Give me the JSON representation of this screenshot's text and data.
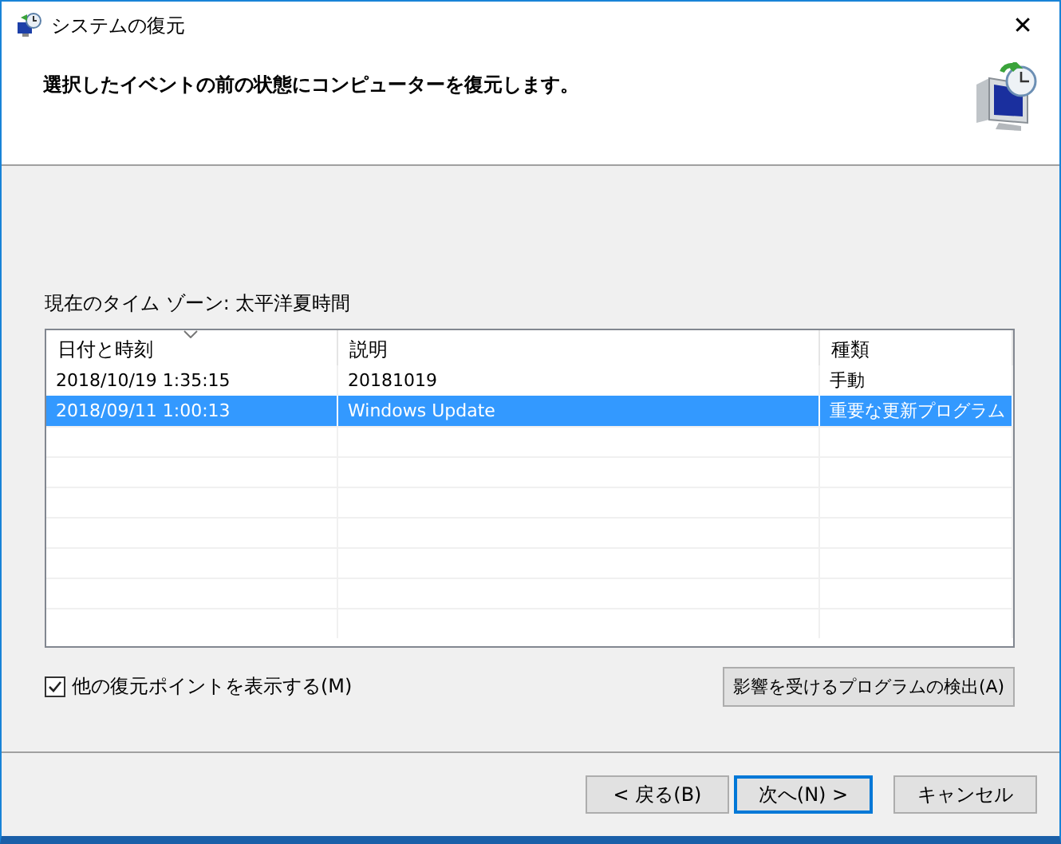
{
  "window": {
    "title": "システムの復元",
    "close": "✕"
  },
  "header": {
    "instruction": "選択したイベントの前の状態にコンピューターを復元します。"
  },
  "timezone": "現在のタイム ゾーン: 太平洋夏時間",
  "table": {
    "columns": [
      "日付と時刻",
      "説明",
      "種類"
    ],
    "rows": [
      {
        "cells": [
          "2018/10/19 1:35:15",
          "20181019",
          "手動"
        ],
        "selected": false
      },
      {
        "cells": [
          "2018/09/11 1:00:13",
          "Windows Update",
          "重要な更新プログラム"
        ],
        "selected": true
      }
    ]
  },
  "show_more": {
    "label": "他の復元ポイントを表示する(M)",
    "checked": true
  },
  "scan_button": "影響を受けるプログラムの検出(A)",
  "buttons": [
    {
      "label": "< 戻る(B)",
      "default": false
    },
    {
      "label": "次へ(N) >",
      "default": true
    },
    {
      "label": "キャンセル",
      "default": false
    }
  ]
}
